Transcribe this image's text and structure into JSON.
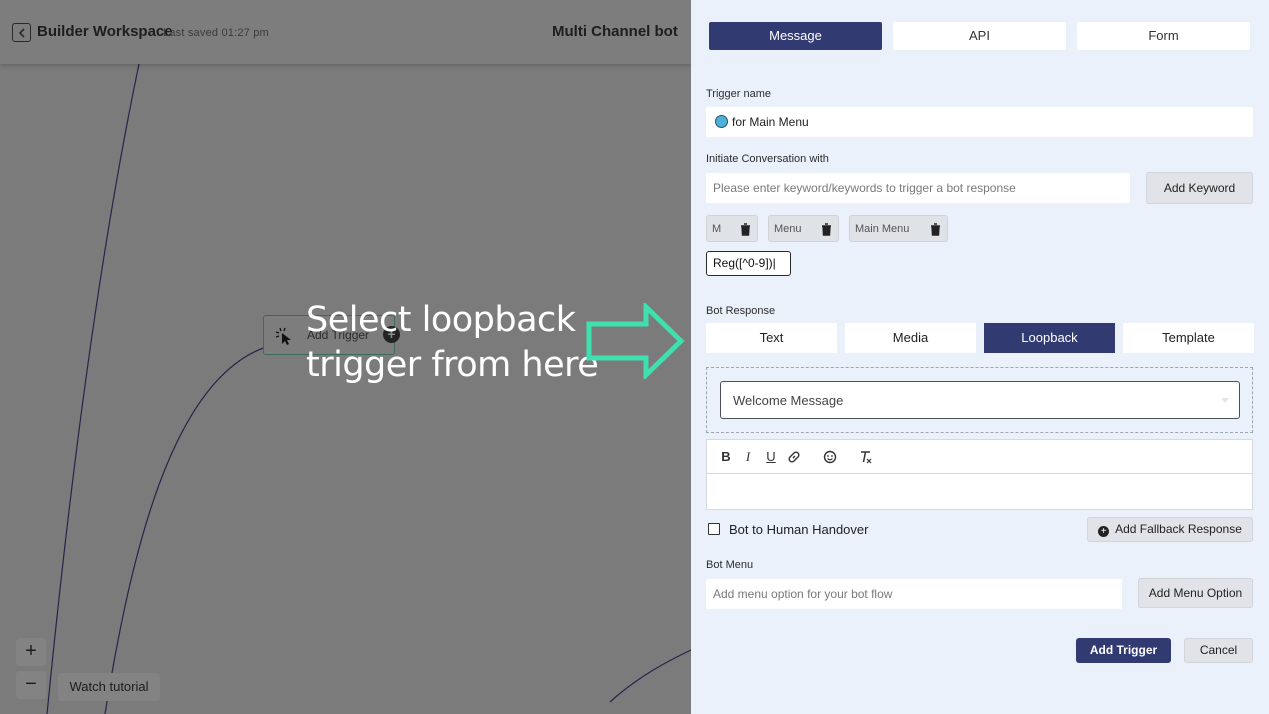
{
  "header": {
    "workspace_title": "Builder Workspace",
    "last_saved": "Last saved 01:27 pm",
    "bot_name": "Multi Channel bot"
  },
  "canvas": {
    "trigger_node_label": "Add Trigger",
    "callout_line1": "Select loopback",
    "callout_line2": "trigger from here",
    "zoom_in_label": "+",
    "zoom_out_label": "−",
    "watch_tutorial_label": "Watch tutorial",
    "callout_color": "#ffffff",
    "arrow_color": "#3ee0b0"
  },
  "panel": {
    "tabs": [
      {
        "label": "Message",
        "active": true
      },
      {
        "label": "API",
        "active": false
      },
      {
        "label": "Form",
        "active": false
      }
    ],
    "trigger_name_label": "Trigger name",
    "trigger_name_value": "for Main Menu",
    "initiate_label": "Initiate Conversation with",
    "keyword_placeholder": "Please enter keyword/keywords to trigger a bot response",
    "add_keyword_label": "Add Keyword",
    "keywords": [
      "M",
      "Menu",
      "Main Menu"
    ],
    "regex_value": "Reg([^0-9])|",
    "bot_response_label": "Bot Response",
    "response_tabs": [
      {
        "label": "Text",
        "active": false
      },
      {
        "label": "Media",
        "active": false
      },
      {
        "label": "Loopback",
        "active": true
      },
      {
        "label": "Template",
        "active": false
      }
    ],
    "loopback_selected": "Welcome Message",
    "editor_tools": [
      "B",
      "I",
      "U",
      "link-icon",
      "emoji-icon",
      "clear-format-icon"
    ],
    "handover_label": "Bot to Human Handover",
    "handover_checked": false,
    "fallback_label": "Add Fallback Response",
    "bot_menu_label": "Bot Menu",
    "menu_placeholder": "Add menu option for your bot flow",
    "add_menu_option_label": "Add Menu Option",
    "add_trigger_label": "Add Trigger",
    "cancel_label": "Cancel",
    "accent_color": "#323a72"
  }
}
